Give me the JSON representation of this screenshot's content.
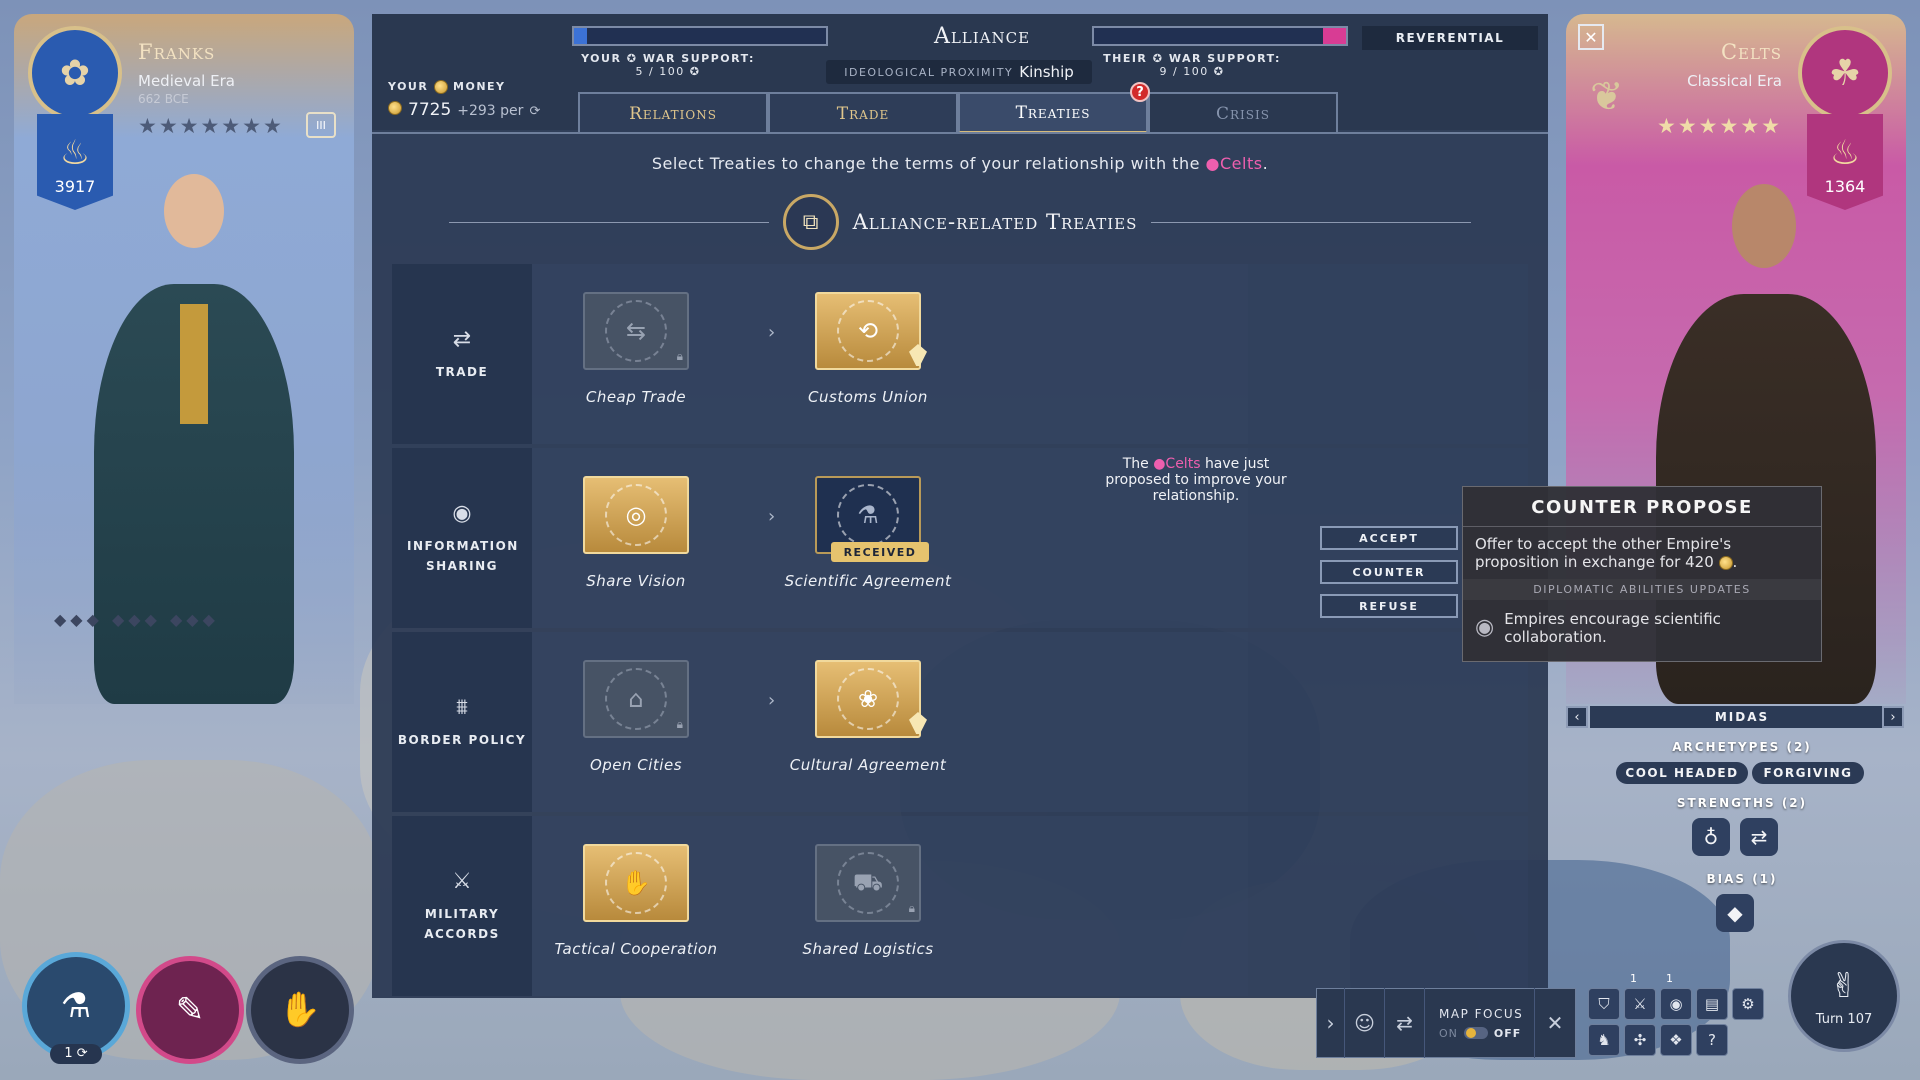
{
  "window": {
    "title": "Alliance",
    "close_icon": "close-icon"
  },
  "colors": {
    "accent_gold": "#e6be74",
    "celts_pink": "#ee5fae",
    "franks_blue": "#2a5bb0",
    "alert_red": "#d22a2a"
  },
  "player": {
    "name": "Franks",
    "era": "Medieval Era",
    "year": "662 BCE",
    "influence": "3917",
    "stars": "★★★★★★★",
    "rank_badge": "III"
  },
  "opponent": {
    "name": "Celts",
    "era": "Classical Era",
    "influence": "1364",
    "stars": "★★★★★★"
  },
  "header": {
    "your_war_support_label": "YOUR",
    "war_support_word": "WAR SUPPORT:",
    "your_war_support_value": "5 / 100",
    "their_war_support_label": "THEIR",
    "their_war_support_value": "9 / 100",
    "your_war_bar": 0.05,
    "their_war_bar": 0.09,
    "ideological_label": "IDEOLOGICAL PROXIMITY",
    "ideological_value": "Kinship",
    "relation_status": "REVERENTIAL",
    "alert_badge": "?"
  },
  "money": {
    "label_your": "YOUR",
    "label_money": "MONEY",
    "amount": "7725",
    "per_turn": "+293 per"
  },
  "tabs": [
    {
      "label": "Relations",
      "state": "normal"
    },
    {
      "label": "Trade",
      "state": "normal"
    },
    {
      "label": "Treaties",
      "state": "active"
    },
    {
      "label": "Crisis",
      "state": "disabled"
    }
  ],
  "instruction": {
    "before": "Select Treaties to change the terms of your relationship with the",
    "celts": "Celts",
    "after": "."
  },
  "section_title": "Alliance-related Treaties",
  "categories": [
    {
      "label": "TRADE",
      "icon": "trade-icon",
      "treaties": [
        {
          "name": "Cheap Trade",
          "style": "gray",
          "icon": "exchange-icon",
          "locked": true
        },
        {
          "name": "Customs Union",
          "style": "gold",
          "icon": "circular-arrows-icon",
          "signed": true
        }
      ]
    },
    {
      "label": "INFORMATION SHARING",
      "icon": "eye-icon",
      "treaties": [
        {
          "name": "Share Vision",
          "style": "gold",
          "icon": "eye-hand-icon"
        },
        {
          "name": "Scientific Agreement",
          "style": "navy",
          "icon": "flask-icon",
          "badge": "RECEIVED"
        }
      ]
    },
    {
      "label": "BORDER POLICY",
      "icon": "fence-icon",
      "treaties": [
        {
          "name": "Open Cities",
          "style": "gray",
          "icon": "city-icon",
          "locked": true
        },
        {
          "name": "Cultural Agreement",
          "style": "gold",
          "icon": "culture-icon",
          "signed": true
        }
      ]
    },
    {
      "label": "MILITARY ACCORDS",
      "icon": "crossed-swords-icon",
      "treaties": [
        {
          "name": "Tactical Cooperation",
          "style": "gold",
          "icon": "handshake-icon"
        },
        {
          "name": "Shared Logistics",
          "style": "gray",
          "icon": "truck-icon",
          "locked": true
        }
      ]
    }
  ],
  "proposal": {
    "before": "The",
    "celts": "Celts",
    "after": "have just proposed to improve your relationship.",
    "accept": "ACCEPT",
    "counter": "COUNTER",
    "refuse": "REFUSE"
  },
  "tooltip": {
    "title": "COUNTER PROPOSE",
    "body": "Offer to accept the other Empire's proposition in exchange for 420",
    "subheader": "DIPLOMATIC ABILITIES UPDATES",
    "effect": "Empires encourage scientific collaboration."
  },
  "persona": {
    "name": "MIDAS",
    "archetypes_label": "ARCHETYPES (2)",
    "archetypes": [
      "COOL HEADED",
      "FORGIVING"
    ],
    "strengths_label": "STRENGTHS (2)",
    "bias_label": "BIAS (1)"
  },
  "bottom_left": {
    "science_count": "1"
  },
  "map_focus": {
    "label": "MAP FOCUS",
    "on": "ON",
    "off": "OFF"
  },
  "tool_counts": [
    "1",
    "1"
  ],
  "turn": {
    "label": "Turn 107"
  }
}
